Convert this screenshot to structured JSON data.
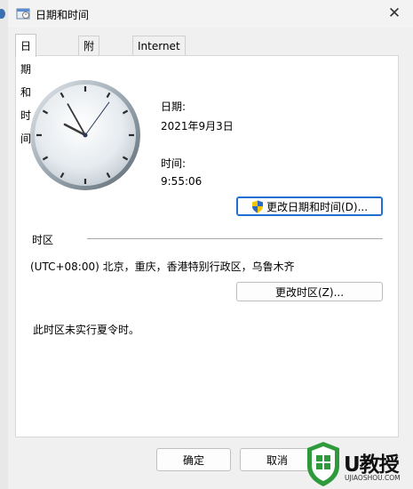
{
  "window": {
    "title": "日期和时间",
    "close_glyph": "✕"
  },
  "tabs": [
    {
      "label": "日期和时间",
      "active": true
    },
    {
      "label": "附加时钟",
      "active": false
    },
    {
      "label": "Internet 时间",
      "active": false
    }
  ],
  "date": {
    "label": "日期:",
    "value": "2021年9月3日"
  },
  "time": {
    "label": "时间:",
    "value": "9:55:06"
  },
  "change_datetime_button": "更改日期和时间(D)...",
  "timezone": {
    "section_label": "时区",
    "value": "(UTC+08:00) 北京，重庆，香港特别行政区，乌鲁木齐",
    "change_button": "更改时区(Z)...",
    "dst_note": "此时区未实行夏令时。"
  },
  "footer": {
    "ok": "确定",
    "cancel": "取消"
  },
  "watermark": {
    "brand": "U教授",
    "sub": "UJIAOSHOU.COM"
  },
  "colors": {
    "accent": "#1f6fd0",
    "watermark_green": "#2f9a3c"
  }
}
